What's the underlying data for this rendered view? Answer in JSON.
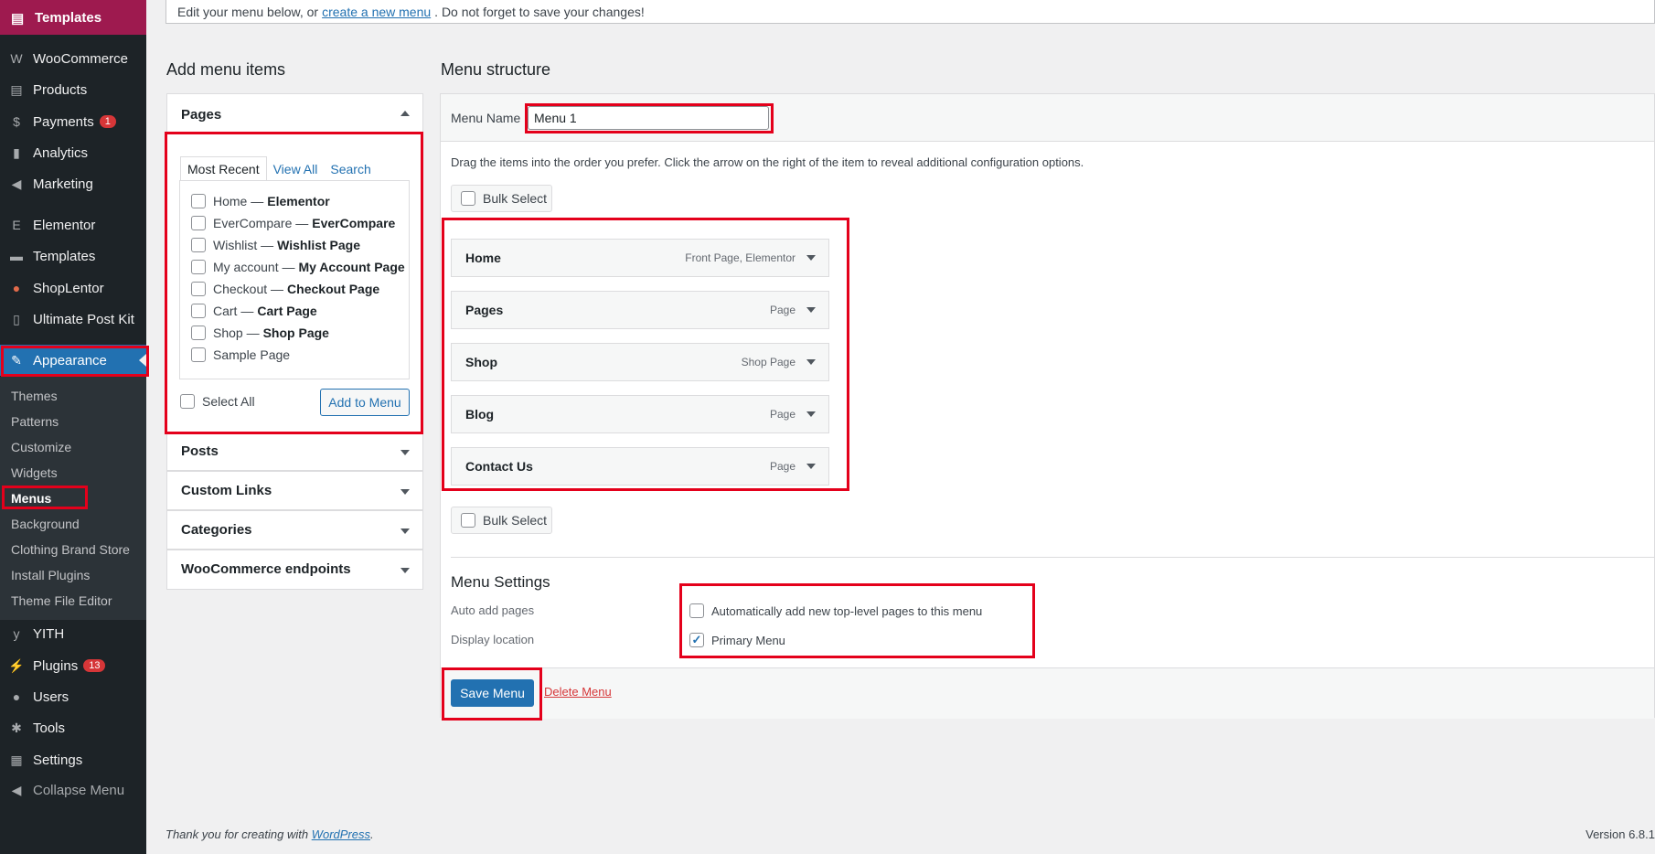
{
  "sidebar": {
    "top_label": "Templates",
    "items": [
      {
        "label": "WooCommerce",
        "icon": "woocommerce-icon",
        "glyph": "W"
      },
      {
        "label": "Products",
        "icon": "products-icon",
        "glyph": "▤"
      },
      {
        "label": "Payments",
        "icon": "payments-icon",
        "glyph": "$",
        "badge": "1"
      },
      {
        "label": "Analytics",
        "icon": "analytics-icon",
        "glyph": "▮"
      },
      {
        "label": "Marketing",
        "icon": "megaphone-icon",
        "glyph": "◀"
      },
      {
        "label": "Elementor",
        "icon": "elementor-icon",
        "glyph": "E"
      },
      {
        "label": "Templates",
        "icon": "folder-icon",
        "glyph": "▬"
      },
      {
        "label": "ShopLentor",
        "icon": "shoplentor-icon",
        "glyph": "●"
      },
      {
        "label": "Ultimate Post Kit",
        "icon": "post-kit-icon",
        "glyph": "▯"
      },
      {
        "label": "Appearance",
        "icon": "paintbrush-icon",
        "glyph": "✎"
      },
      {
        "label": "YITH",
        "icon": "yith-icon",
        "glyph": "y"
      },
      {
        "label": "Plugins",
        "icon": "plugin-icon",
        "glyph": "⚡",
        "badge": "13"
      },
      {
        "label": "Users",
        "icon": "user-icon",
        "glyph": "●"
      },
      {
        "label": "Tools",
        "icon": "wrench-icon",
        "glyph": "✱"
      },
      {
        "label": "Settings",
        "icon": "settings-icon",
        "glyph": "▦"
      },
      {
        "label": "Collapse Menu",
        "icon": "collapse-icon",
        "glyph": "◀"
      }
    ],
    "appearance_sub": [
      "Themes",
      "Patterns",
      "Customize",
      "Widgets",
      "Menus",
      "Background",
      "Clothing Brand Store",
      "Install Plugins",
      "Theme File Editor"
    ]
  },
  "notice": {
    "prefix": "Edit your menu below, or",
    "link": "create a new menu",
    "suffix": ". Do not forget to save your changes!"
  },
  "add_items": {
    "heading": "Add menu items",
    "pages_title": "Pages",
    "tabs": [
      "Most Recent",
      "View All",
      "Search"
    ],
    "pages": [
      {
        "title": "Home",
        "sep": "—",
        "tag": "Elementor"
      },
      {
        "title": "EverCompare",
        "sep": "—",
        "tag": "EverCompare"
      },
      {
        "title": "Wishlist",
        "sep": "—",
        "tag": "Wishlist Page"
      },
      {
        "title": "My account",
        "sep": "—",
        "tag": "My Account Page"
      },
      {
        "title": "Checkout",
        "sep": "—",
        "tag": "Checkout Page"
      },
      {
        "title": "Cart",
        "sep": "—",
        "tag": "Cart Page"
      },
      {
        "title": "Shop",
        "sep": "—",
        "tag": "Shop Page"
      },
      {
        "title": "Sample Page",
        "sep": "",
        "tag": ""
      }
    ],
    "select_all": "Select All",
    "add_button": "Add to Menu",
    "sections": [
      "Posts",
      "Custom Links",
      "Categories",
      "WooCommerce endpoints"
    ]
  },
  "structure": {
    "heading": "Menu structure",
    "menu_name_label": "Menu Name",
    "menu_name_value": "Menu 1",
    "instructions": "Drag the items into the order you prefer. Click the arrow on the right of the item to reveal additional configuration options.",
    "bulk_select": "Bulk Select",
    "items": [
      {
        "title": "Home",
        "type": "Front Page, Elementor"
      },
      {
        "title": "Pages",
        "type": "Page"
      },
      {
        "title": "Shop",
        "type": "Shop Page"
      },
      {
        "title": "Blog",
        "type": "Page"
      },
      {
        "title": "Contact Us",
        "type": "Page"
      }
    ],
    "settings_heading": "Menu Settings",
    "auto_add_label": "Auto add pages",
    "auto_add_option": "Automatically add new top-level pages to this menu",
    "display_location_label": "Display location",
    "display_location_option": "Primary Menu",
    "auto_add_checked": false,
    "primary_menu_checked": true,
    "save_button": "Save Menu",
    "delete_link": "Delete Menu"
  },
  "footer": {
    "prefix": "Thank you for creating with",
    "link": "WordPress",
    "suffix": ".",
    "version": "Version 6.8.1"
  },
  "colors": {
    "sidebar_bg": "#1d2327",
    "accent": "#2271b1",
    "highlight": "#e4001b",
    "top_item": "#9e1a4f"
  }
}
